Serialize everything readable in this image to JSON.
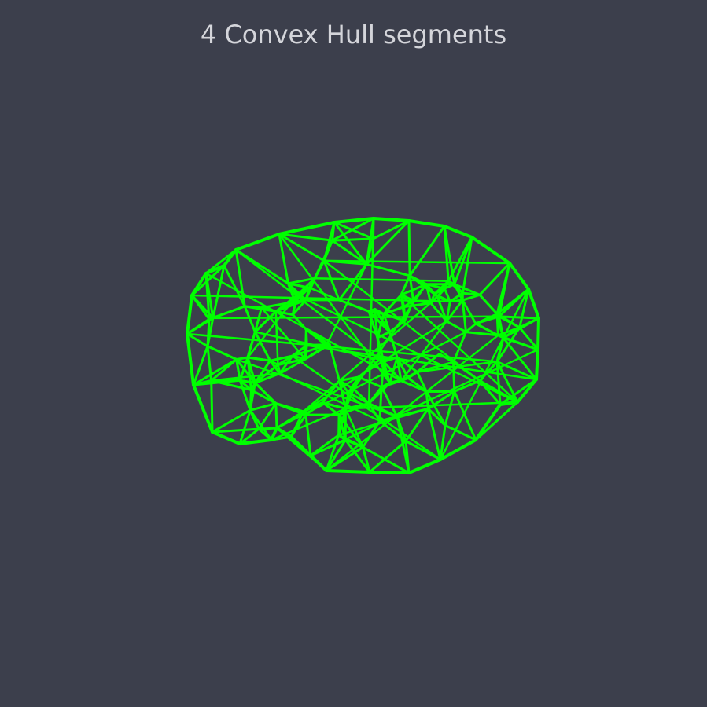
{
  "scene": {
    "title": "4 Convex Hull segments",
    "background_color": "#3c3f4c",
    "title_color": "#d4d5da",
    "wireframe_color": "#00ff00",
    "render_style": "wireframe"
  }
}
